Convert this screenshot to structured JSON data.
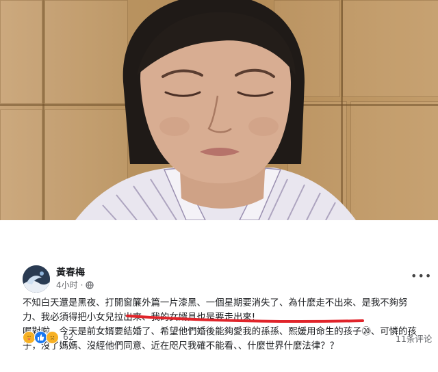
{
  "photo": {
    "description_label": ""
  },
  "post": {
    "author": "黃春梅",
    "time": "4小时",
    "privacy_icon": "globe-icon",
    "more_icon": "more-options-icon",
    "body_lines": [
      "不知白天還是黑夜、打開窗簾外篇一片漆黑、一個星期要消失了、為什麼走不出來、是我不夠努",
      "力、我必須得把小女兒拉出來、我的女婿具也是要走出來!",
      "喔對啦，今天是前女婿要結婚了、希望他們婚後能夠愛我的孫孫、熙媛用命生的孩子⑳、可憐的孩",
      "子，沒了媽媽、沒經他們同意、近在咫尺我確不能看、、什麼世界什麼法律？？"
    ],
    "reactions": {
      "icons": [
        "care-icon",
        "like-icon",
        "sad-icon"
      ],
      "count": "62"
    },
    "comments": "11条评论"
  },
  "colors": {
    "text": "#1c1e21",
    "meta": "#65676b",
    "underline": "#e0242a",
    "like": "#1877f2",
    "reaction_yellow": "#f7b125"
  }
}
